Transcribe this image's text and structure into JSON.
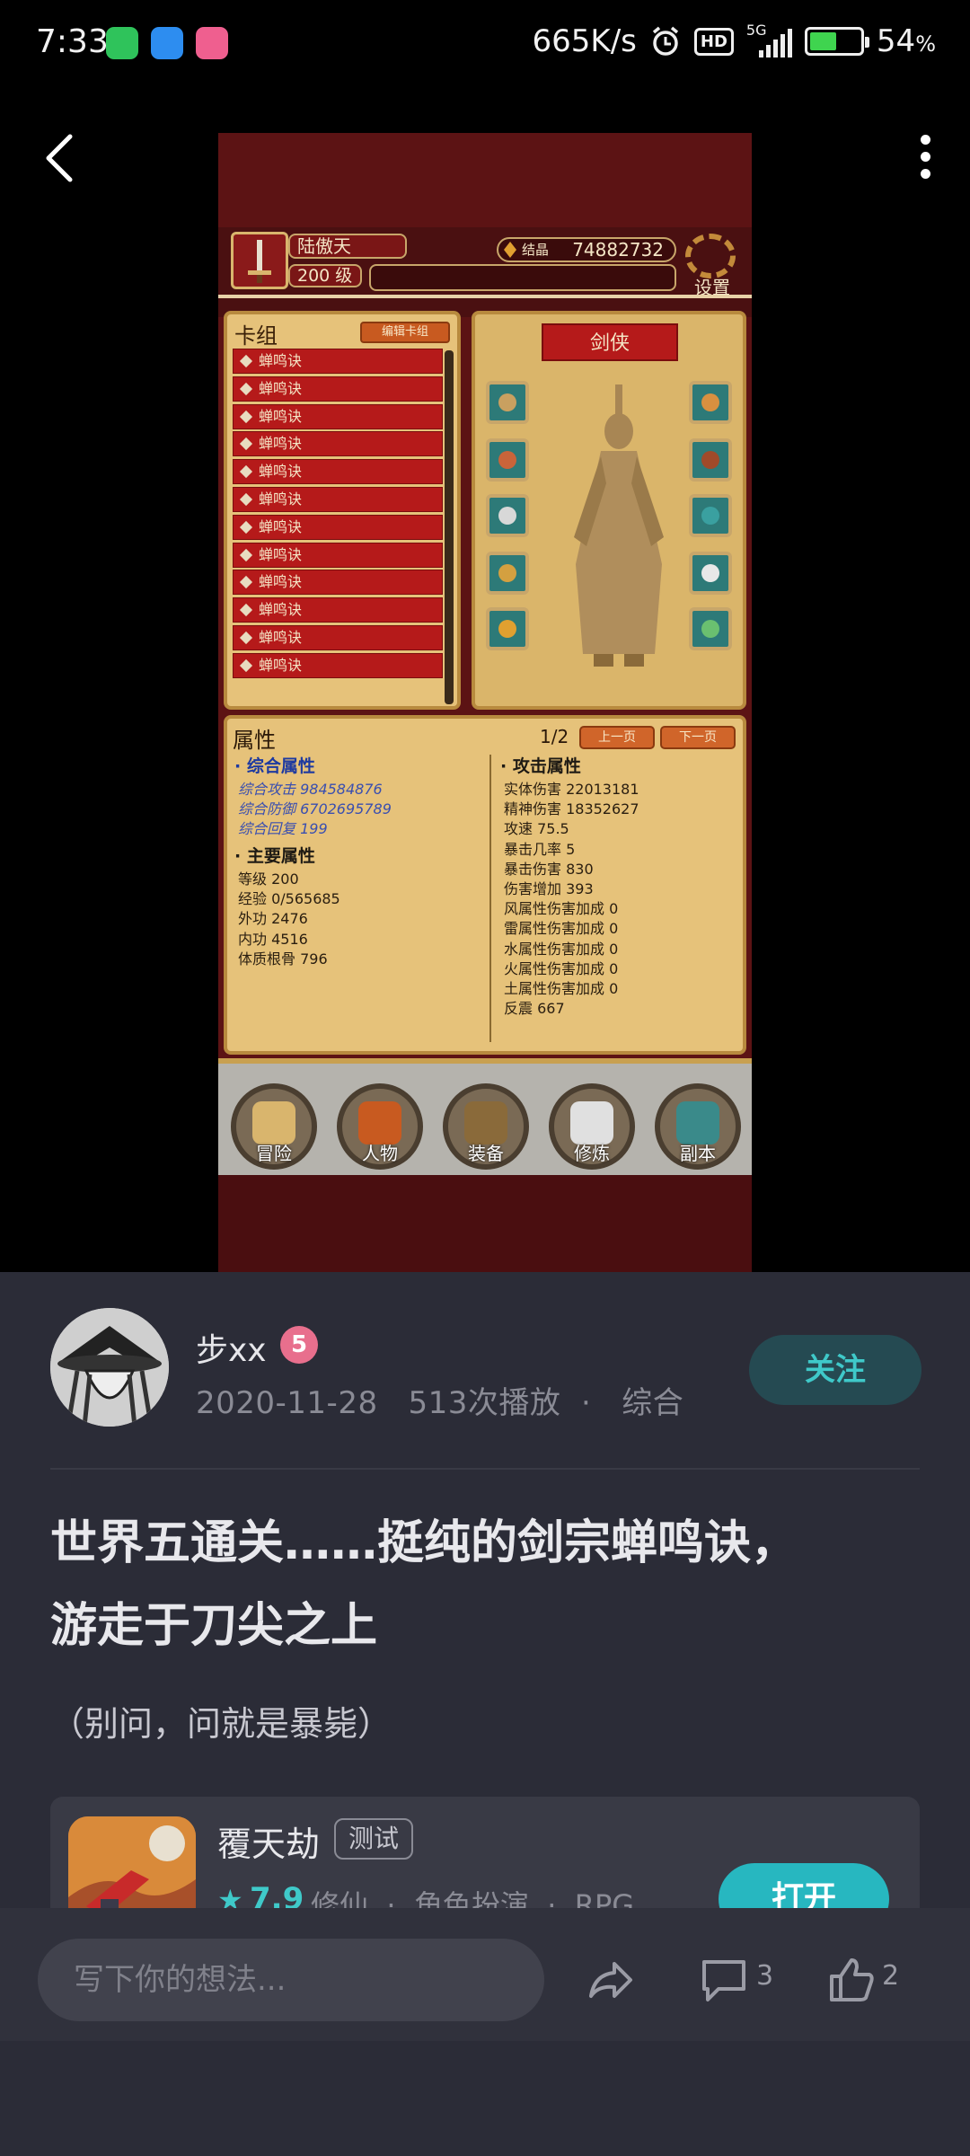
{
  "status": {
    "time": "7:33",
    "net_speed": "665K/s",
    "signal": "5G",
    "battery": "54",
    "battery_fraction": 0.54,
    "hd": "HD",
    "percent_sign": "%"
  },
  "video": {
    "game": {
      "player_name": "陆傲天",
      "player_level": "200 级",
      "crystal_label": "结晶",
      "crystal_value": "74882732",
      "settings_label": "设置",
      "cards_title": "卡组",
      "edit_cards": "编辑卡组",
      "cards": [
        "蝉鸣诀",
        "蝉鸣诀",
        "蝉鸣诀",
        "蝉鸣诀",
        "蝉鸣诀",
        "蝉鸣诀",
        "蝉鸣诀",
        "蝉鸣诀",
        "蝉鸣诀",
        "蝉鸣诀",
        "蝉鸣诀",
        "蝉鸣诀"
      ],
      "hero_title": "剑侠",
      "attrs_title": "属性",
      "page": "1/2",
      "prev": "上一页",
      "next": "下一页",
      "combined_title": "· 综合属性",
      "combined": [
        "综合攻击 984584876",
        "综合防御 6702695789",
        "综合回复 199"
      ],
      "main_title": "· 主要属性",
      "main": [
        "等级 200",
        "经验 0/565685",
        "外功 2476",
        "内功 4516",
        "体质根骨 796"
      ],
      "attack_title": "· 攻击属性",
      "attack": [
        "实体伤害 22013181",
        "精神伤害 18352627",
        "攻速 75.5",
        "暴击几率 5",
        "暴击伤害 830",
        "伤害增加 393",
        "风属性伤害加成 0",
        "雷属性伤害加成 0",
        "水属性伤害加成 0",
        "火属性伤害加成 0",
        "土属性伤害加成 0",
        "反震 667"
      ],
      "nav": [
        "冒险",
        "人物",
        "装备",
        "修炼",
        "副本"
      ]
    }
  },
  "author": {
    "name": "步xx",
    "badge": "5",
    "date": "2020-11-28",
    "plays": "513次播放",
    "category": "综合",
    "follow_label": "关注"
  },
  "post": {
    "title_line1": "世界五通关……挺纯的剑宗蝉鸣诀，",
    "title_line2": "游走于刀尖之上",
    "subtitle": "（别问，问就是暴毙）"
  },
  "game_card": {
    "name": "覆天劫",
    "tag": "测试",
    "score": "7.9",
    "genres": [
      "修仙",
      "角色扮演",
      "RPG"
    ],
    "open_label": "打开"
  },
  "bottom": {
    "placeholder": "写下你的想法...",
    "comments": "3",
    "likes": "2"
  },
  "colors": {
    "accent": "#3fc9c9",
    "sheet_bg": "#2b2c37",
    "open_btn": "#27b7c0"
  }
}
